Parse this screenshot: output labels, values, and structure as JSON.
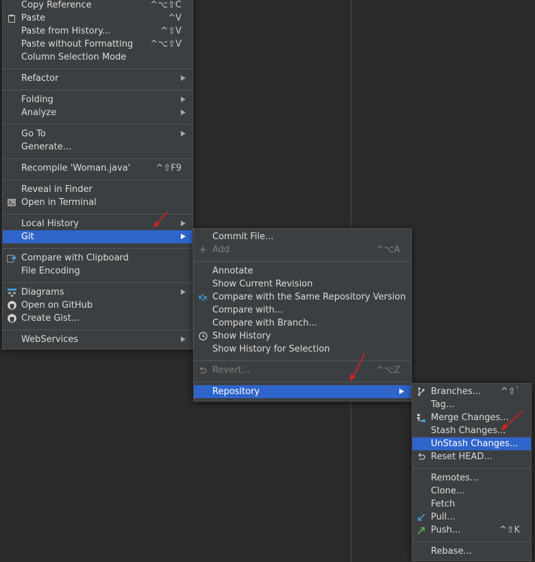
{
  "main_menu": {
    "items": [
      {
        "label": "Copy Reference",
        "shortcut": "^⌥⇧C"
      },
      {
        "label": "Paste",
        "shortcut": "^V"
      },
      {
        "label": "Paste from History...",
        "shortcut": "^⇧V"
      },
      {
        "label": "Paste without Formatting",
        "shortcut": "^⌥⇧V"
      },
      {
        "label": "Column Selection Mode",
        "shortcut": ""
      },
      {
        "label": "Refactor",
        "shortcut": ""
      },
      {
        "label": "Folding",
        "shortcut": ""
      },
      {
        "label": "Analyze",
        "shortcut": ""
      },
      {
        "label": "Go To",
        "shortcut": ""
      },
      {
        "label": "Generate...",
        "shortcut": ""
      },
      {
        "label": "Recompile 'Woman.java'",
        "shortcut": "^⇧F9"
      },
      {
        "label": "Reveal in Finder",
        "shortcut": ""
      },
      {
        "label": "Open in Terminal",
        "shortcut": ""
      },
      {
        "label": "Local History",
        "shortcut": ""
      },
      {
        "label": "Git",
        "shortcut": ""
      },
      {
        "label": "Compare with Clipboard",
        "shortcut": ""
      },
      {
        "label": "File Encoding",
        "shortcut": ""
      },
      {
        "label": "Diagrams",
        "shortcut": ""
      },
      {
        "label": "Open on GitHub",
        "shortcut": ""
      },
      {
        "label": "Create Gist...",
        "shortcut": ""
      },
      {
        "label": "WebServices",
        "shortcut": ""
      }
    ]
  },
  "git_menu": {
    "items": [
      {
        "label": "Commit File...",
        "shortcut": ""
      },
      {
        "label": "Add",
        "shortcut": "^⌥A"
      },
      {
        "label": "Annotate",
        "shortcut": ""
      },
      {
        "label": "Show Current Revision",
        "shortcut": ""
      },
      {
        "label": "Compare with the Same Repository Version",
        "shortcut": ""
      },
      {
        "label": "Compare with...",
        "shortcut": ""
      },
      {
        "label": "Compare with Branch...",
        "shortcut": ""
      },
      {
        "label": "Show History",
        "shortcut": ""
      },
      {
        "label": "Show History for Selection",
        "shortcut": ""
      },
      {
        "label": "Revert...",
        "shortcut": "^⌥Z"
      },
      {
        "label": "Repository",
        "shortcut": ""
      }
    ]
  },
  "repository_menu": {
    "items": [
      {
        "label": "Branches...",
        "shortcut": "^⇧`"
      },
      {
        "label": "Tag...",
        "shortcut": ""
      },
      {
        "label": "Merge Changes...",
        "shortcut": ""
      },
      {
        "label": "Stash Changes...",
        "shortcut": ""
      },
      {
        "label": "UnStash Changes...",
        "shortcut": ""
      },
      {
        "label": "Reset HEAD...",
        "shortcut": ""
      },
      {
        "label": "Remotes...",
        "shortcut": ""
      },
      {
        "label": "Clone...",
        "shortcut": ""
      },
      {
        "label": "Fetch",
        "shortcut": ""
      },
      {
        "label": "Pull...",
        "shortcut": ""
      },
      {
        "label": "Push...",
        "shortcut": "^⇧K"
      },
      {
        "label": "Rebase...",
        "shortcut": ""
      }
    ]
  },
  "colors": {
    "background": "#2b2b2b",
    "menu_background": "#3c3f41",
    "selection": "#2f65ca",
    "annotation_arrow": "#e02020"
  }
}
